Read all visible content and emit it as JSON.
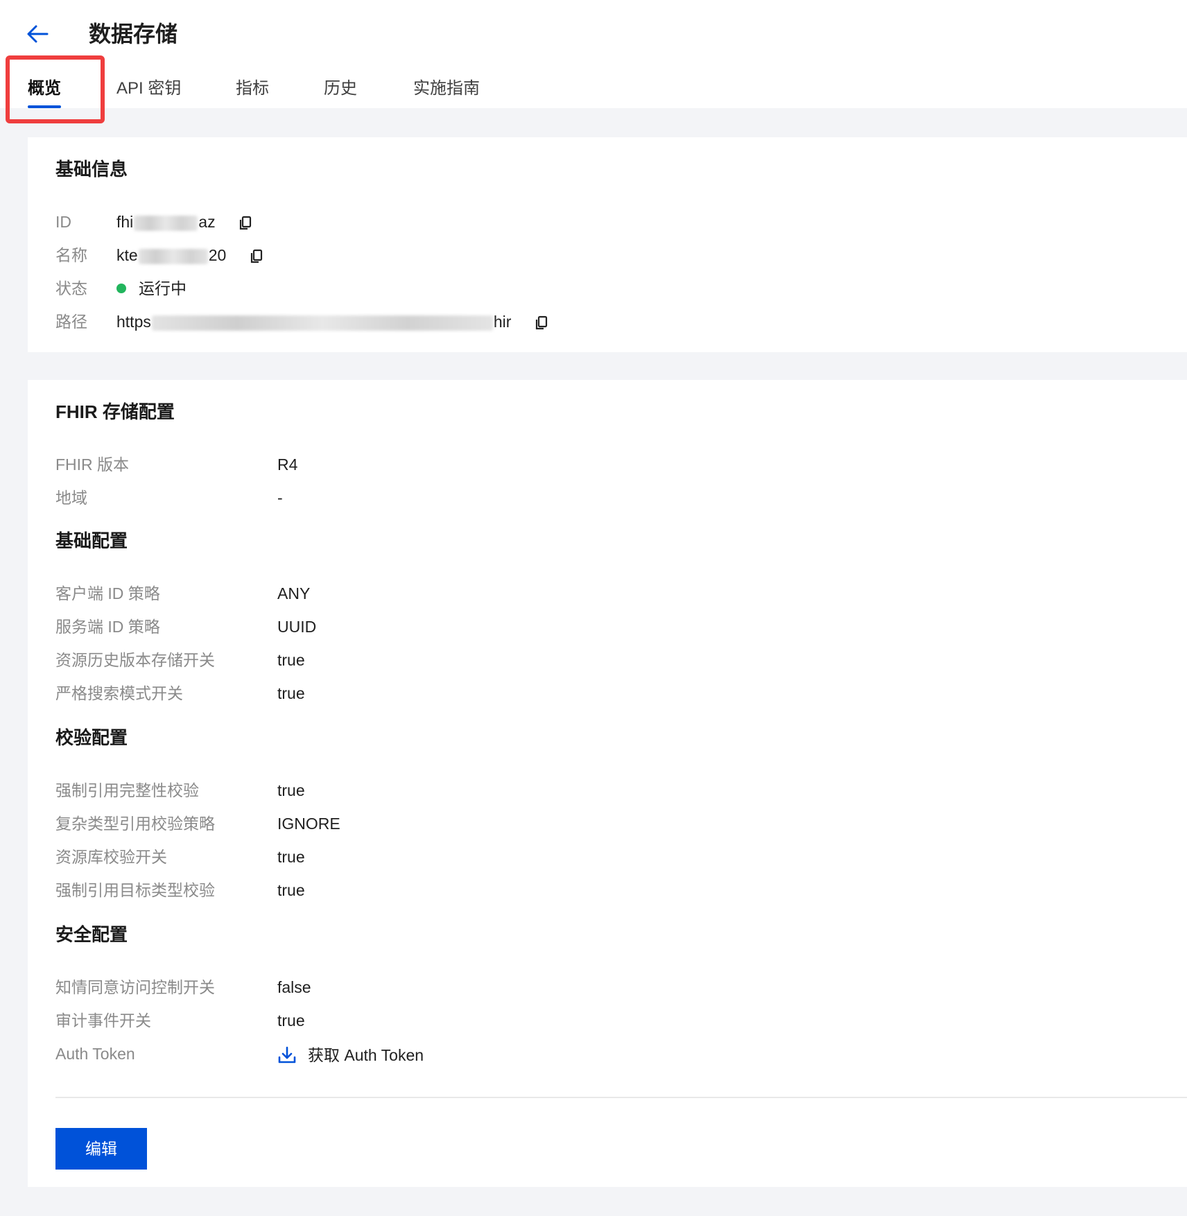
{
  "header": {
    "title": "数据存储",
    "back_icon": "arrow-left-icon"
  },
  "tabs": [
    {
      "label": "概览",
      "active": true
    },
    {
      "label": "API 密钥",
      "active": false
    },
    {
      "label": "指标",
      "active": false
    },
    {
      "label": "历史",
      "active": false
    },
    {
      "label": "实施指南",
      "active": false
    }
  ],
  "basic_info": {
    "title": "基础信息",
    "id": {
      "label": "ID",
      "value_prefix": "fhi",
      "value_suffix": "az"
    },
    "name": {
      "label": "名称",
      "value_prefix": "kte",
      "value_suffix": "20"
    },
    "status": {
      "label": "状态",
      "value": "运行中",
      "color": "#22b55d"
    },
    "path": {
      "label": "路径",
      "value_prefix": "https",
      "value_suffix": "hir"
    }
  },
  "fhir_config": {
    "title": "FHIR 存储配置",
    "version": {
      "label": "FHIR 版本",
      "value": "R4"
    },
    "region": {
      "label": "地域",
      "value": "-"
    }
  },
  "base_config": {
    "title": "基础配置",
    "client_id_policy": {
      "label": "客户端 ID 策略",
      "value": "ANY"
    },
    "server_id_policy": {
      "label": "服务端 ID 策略",
      "value": "UUID"
    },
    "history_switch": {
      "label": "资源历史版本存储开关",
      "value": "true"
    },
    "strict_search": {
      "label": "严格搜索模式开关",
      "value": "true"
    }
  },
  "validation_config": {
    "title": "校验配置",
    "ref_integrity": {
      "label": "强制引用完整性校验",
      "value": "true"
    },
    "complex_ref": {
      "label": "复杂类型引用校验策略",
      "value": "IGNORE"
    },
    "repo_validation": {
      "label": "资源库校验开关",
      "value": "true"
    },
    "ref_target_type": {
      "label": "强制引用目标类型校验",
      "value": "true"
    }
  },
  "security_config": {
    "title": "安全配置",
    "consent_switch": {
      "label": "知情同意访问控制开关",
      "value": "false"
    },
    "audit_switch": {
      "label": "审计事件开关",
      "value": "true"
    },
    "auth_token": {
      "label": "Auth Token",
      "link_label": "获取 Auth Token"
    }
  },
  "actions": {
    "edit_label": "编辑"
  },
  "colors": {
    "accent": "#0052d9",
    "highlight": "#ef3e3e"
  }
}
